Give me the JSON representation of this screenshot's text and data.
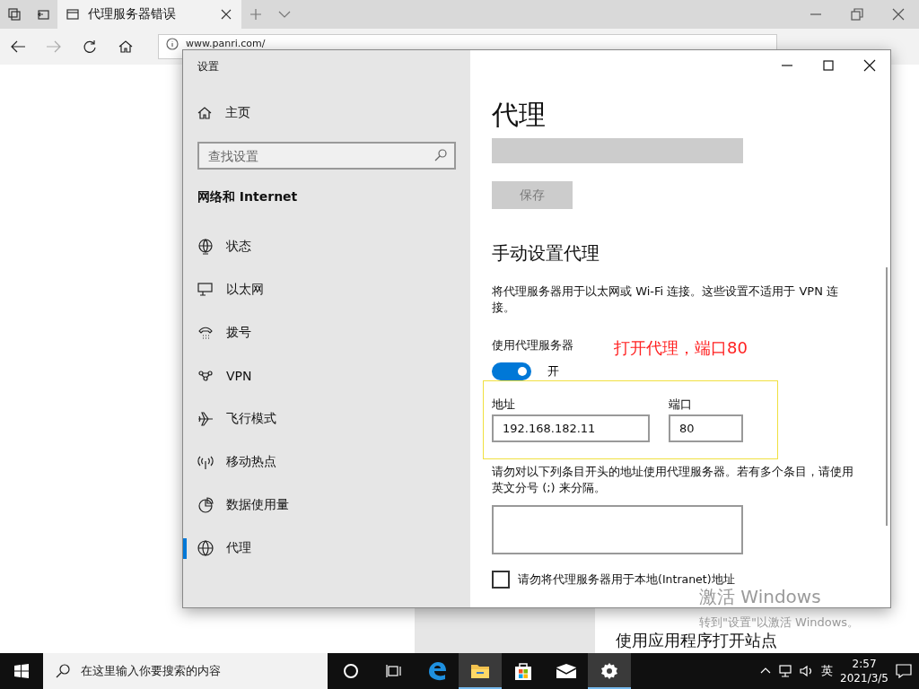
{
  "browser": {
    "tab": {
      "title": "代理服务器错误"
    },
    "address": "www.panri.com/"
  },
  "background_window": {
    "heading": "使用应用程序打开站点"
  },
  "settings": {
    "title": "设置",
    "home": "主页",
    "search": {
      "placeholder": "查找设置"
    },
    "section": "网络和 Internet",
    "nav": [
      {
        "label": "状态",
        "kind": "status",
        "selected": false
      },
      {
        "label": "以太网",
        "kind": "ethernet",
        "selected": false
      },
      {
        "label": "拨号",
        "kind": "dialup",
        "selected": false
      },
      {
        "label": "VPN",
        "kind": "vpn",
        "selected": false
      },
      {
        "label": "飞行模式",
        "kind": "airplane",
        "selected": false
      },
      {
        "label": "移动热点",
        "kind": "hotspot",
        "selected": false
      },
      {
        "label": "数据使用量",
        "kind": "data",
        "selected": false
      },
      {
        "label": "代理",
        "kind": "proxy",
        "selected": true
      }
    ],
    "page": {
      "title": "代理",
      "save": {
        "label": "保存",
        "disabled": true
      },
      "manual_heading": "手动设置代理",
      "description": "将代理服务器用于以太网或 Wi-Fi 连接。这些设置不适用于 VPN 连接。",
      "use_proxy": {
        "label": "使用代理服务器",
        "on": true,
        "state": "开"
      },
      "address": {
        "label": "地址",
        "value": "192.168.182.11"
      },
      "port": {
        "label": "端口",
        "value": "80"
      },
      "exceptions": {
        "description": "请勿对以下列条目开头的地址使用代理服务器。若有多个条目，请使用英文分号 (;) 来分隔。"
      },
      "local_bypass": {
        "label": "请勿将代理服务器用于本地(Intranet)地址",
        "checked": false
      }
    }
  },
  "annotation": {
    "text": "打开代理，端口80"
  },
  "activation": {
    "title": "激活 Windows",
    "subtitle": "转到\"设置\"以激活 Windows。"
  },
  "taskbar": {
    "search": {
      "placeholder": "在这里输入你要搜索的内容"
    },
    "apps": [
      {
        "kind": "cortana",
        "selected": false
      },
      {
        "kind": "taskview",
        "selected": false
      },
      {
        "kind": "edge",
        "selected": false
      },
      {
        "kind": "explorer",
        "selected": true
      },
      {
        "kind": "store",
        "selected": false
      },
      {
        "kind": "mail",
        "selected": false
      },
      {
        "kind": "settings",
        "selected": true
      }
    ],
    "language": "英",
    "time": "2:57",
    "date": "2021/3/5"
  }
}
